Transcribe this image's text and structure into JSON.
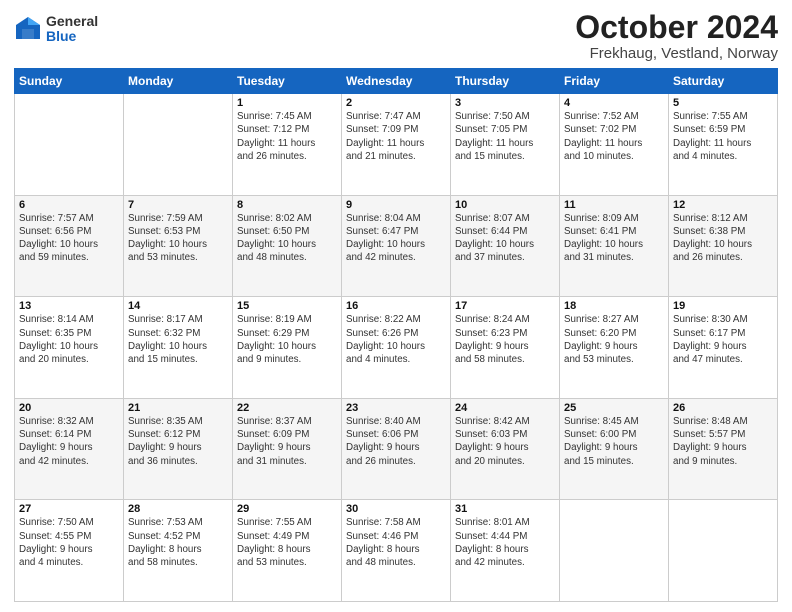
{
  "header": {
    "logo": {
      "general": "General",
      "blue": "Blue"
    },
    "title": "October 2024",
    "subtitle": "Frekhaug, Vestland, Norway"
  },
  "weekdays": [
    "Sunday",
    "Monday",
    "Tuesday",
    "Wednesday",
    "Thursday",
    "Friday",
    "Saturday"
  ],
  "weeks": [
    [
      {
        "day": "",
        "info": ""
      },
      {
        "day": "",
        "info": ""
      },
      {
        "day": "1",
        "info": "Sunrise: 7:45 AM\nSunset: 7:12 PM\nDaylight: 11 hours\nand 26 minutes."
      },
      {
        "day": "2",
        "info": "Sunrise: 7:47 AM\nSunset: 7:09 PM\nDaylight: 11 hours\nand 21 minutes."
      },
      {
        "day": "3",
        "info": "Sunrise: 7:50 AM\nSunset: 7:05 PM\nDaylight: 11 hours\nand 15 minutes."
      },
      {
        "day": "4",
        "info": "Sunrise: 7:52 AM\nSunset: 7:02 PM\nDaylight: 11 hours\nand 10 minutes."
      },
      {
        "day": "5",
        "info": "Sunrise: 7:55 AM\nSunset: 6:59 PM\nDaylight: 11 hours\nand 4 minutes."
      }
    ],
    [
      {
        "day": "6",
        "info": "Sunrise: 7:57 AM\nSunset: 6:56 PM\nDaylight: 10 hours\nand 59 minutes."
      },
      {
        "day": "7",
        "info": "Sunrise: 7:59 AM\nSunset: 6:53 PM\nDaylight: 10 hours\nand 53 minutes."
      },
      {
        "day": "8",
        "info": "Sunrise: 8:02 AM\nSunset: 6:50 PM\nDaylight: 10 hours\nand 48 minutes."
      },
      {
        "day": "9",
        "info": "Sunrise: 8:04 AM\nSunset: 6:47 PM\nDaylight: 10 hours\nand 42 minutes."
      },
      {
        "day": "10",
        "info": "Sunrise: 8:07 AM\nSunset: 6:44 PM\nDaylight: 10 hours\nand 37 minutes."
      },
      {
        "day": "11",
        "info": "Sunrise: 8:09 AM\nSunset: 6:41 PM\nDaylight: 10 hours\nand 31 minutes."
      },
      {
        "day": "12",
        "info": "Sunrise: 8:12 AM\nSunset: 6:38 PM\nDaylight: 10 hours\nand 26 minutes."
      }
    ],
    [
      {
        "day": "13",
        "info": "Sunrise: 8:14 AM\nSunset: 6:35 PM\nDaylight: 10 hours\nand 20 minutes."
      },
      {
        "day": "14",
        "info": "Sunrise: 8:17 AM\nSunset: 6:32 PM\nDaylight: 10 hours\nand 15 minutes."
      },
      {
        "day": "15",
        "info": "Sunrise: 8:19 AM\nSunset: 6:29 PM\nDaylight: 10 hours\nand 9 minutes."
      },
      {
        "day": "16",
        "info": "Sunrise: 8:22 AM\nSunset: 6:26 PM\nDaylight: 10 hours\nand 4 minutes."
      },
      {
        "day": "17",
        "info": "Sunrise: 8:24 AM\nSunset: 6:23 PM\nDaylight: 9 hours\nand 58 minutes."
      },
      {
        "day": "18",
        "info": "Sunrise: 8:27 AM\nSunset: 6:20 PM\nDaylight: 9 hours\nand 53 minutes."
      },
      {
        "day": "19",
        "info": "Sunrise: 8:30 AM\nSunset: 6:17 PM\nDaylight: 9 hours\nand 47 minutes."
      }
    ],
    [
      {
        "day": "20",
        "info": "Sunrise: 8:32 AM\nSunset: 6:14 PM\nDaylight: 9 hours\nand 42 minutes."
      },
      {
        "day": "21",
        "info": "Sunrise: 8:35 AM\nSunset: 6:12 PM\nDaylight: 9 hours\nand 36 minutes."
      },
      {
        "day": "22",
        "info": "Sunrise: 8:37 AM\nSunset: 6:09 PM\nDaylight: 9 hours\nand 31 minutes."
      },
      {
        "day": "23",
        "info": "Sunrise: 8:40 AM\nSunset: 6:06 PM\nDaylight: 9 hours\nand 26 minutes."
      },
      {
        "day": "24",
        "info": "Sunrise: 8:42 AM\nSunset: 6:03 PM\nDaylight: 9 hours\nand 20 minutes."
      },
      {
        "day": "25",
        "info": "Sunrise: 8:45 AM\nSunset: 6:00 PM\nDaylight: 9 hours\nand 15 minutes."
      },
      {
        "day": "26",
        "info": "Sunrise: 8:48 AM\nSunset: 5:57 PM\nDaylight: 9 hours\nand 9 minutes."
      }
    ],
    [
      {
        "day": "27",
        "info": "Sunrise: 7:50 AM\nSunset: 4:55 PM\nDaylight: 9 hours\nand 4 minutes."
      },
      {
        "day": "28",
        "info": "Sunrise: 7:53 AM\nSunset: 4:52 PM\nDaylight: 8 hours\nand 58 minutes."
      },
      {
        "day": "29",
        "info": "Sunrise: 7:55 AM\nSunset: 4:49 PM\nDaylight: 8 hours\nand 53 minutes."
      },
      {
        "day": "30",
        "info": "Sunrise: 7:58 AM\nSunset: 4:46 PM\nDaylight: 8 hours\nand 48 minutes."
      },
      {
        "day": "31",
        "info": "Sunrise: 8:01 AM\nSunset: 4:44 PM\nDaylight: 8 hours\nand 42 minutes."
      },
      {
        "day": "",
        "info": ""
      },
      {
        "day": "",
        "info": ""
      }
    ]
  ]
}
